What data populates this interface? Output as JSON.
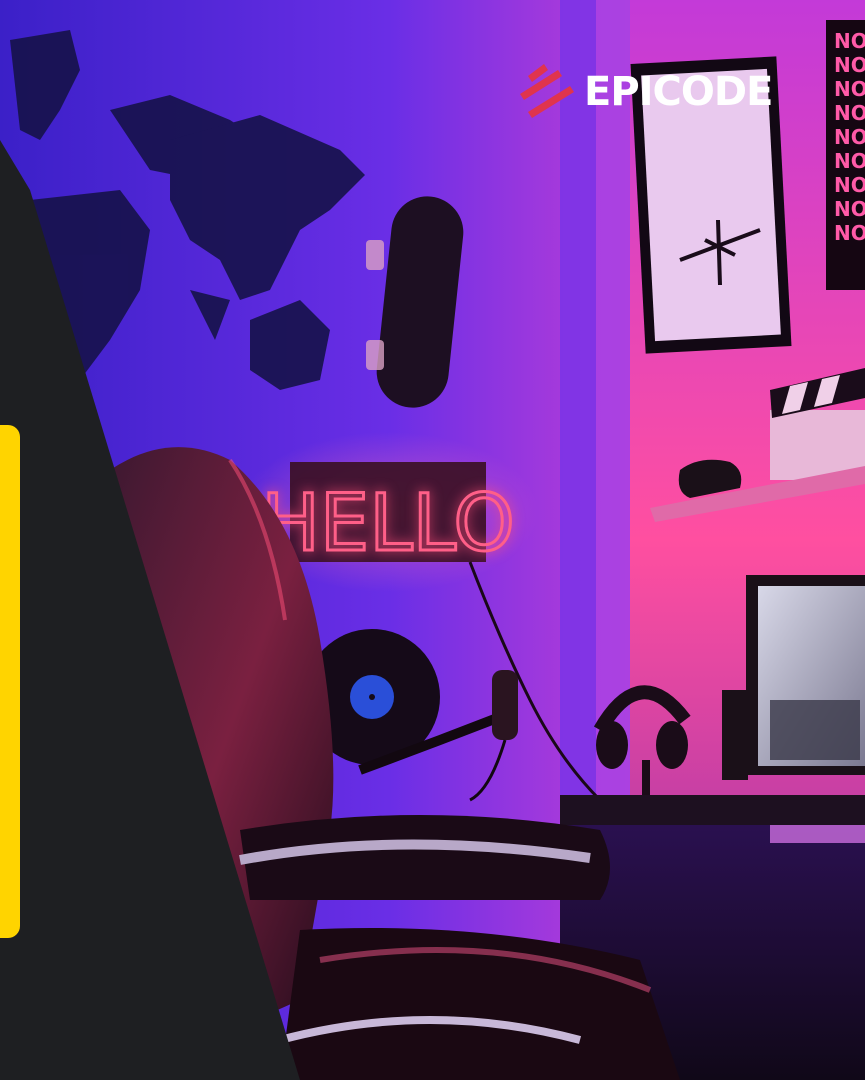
{
  "brand": {
    "name": "EPICODE",
    "logo_icon": "epicode-slashes-icon"
  },
  "scene": {
    "neon_sign": "HELLO",
    "poster_text": [
      "NOV",
      "NOV",
      "NOV",
      "NOV",
      "NO",
      "NO",
      "NO",
      "NO",
      "NO"
    ]
  },
  "colors": {
    "dark_panel": "#1e1f22",
    "accent_yellow": "#ffd400",
    "neon_pink": "#ff4f7a",
    "wall_purple": "#5a2fe0",
    "wall_magenta": "#d83fd2",
    "brand_red": "#e0344d"
  }
}
